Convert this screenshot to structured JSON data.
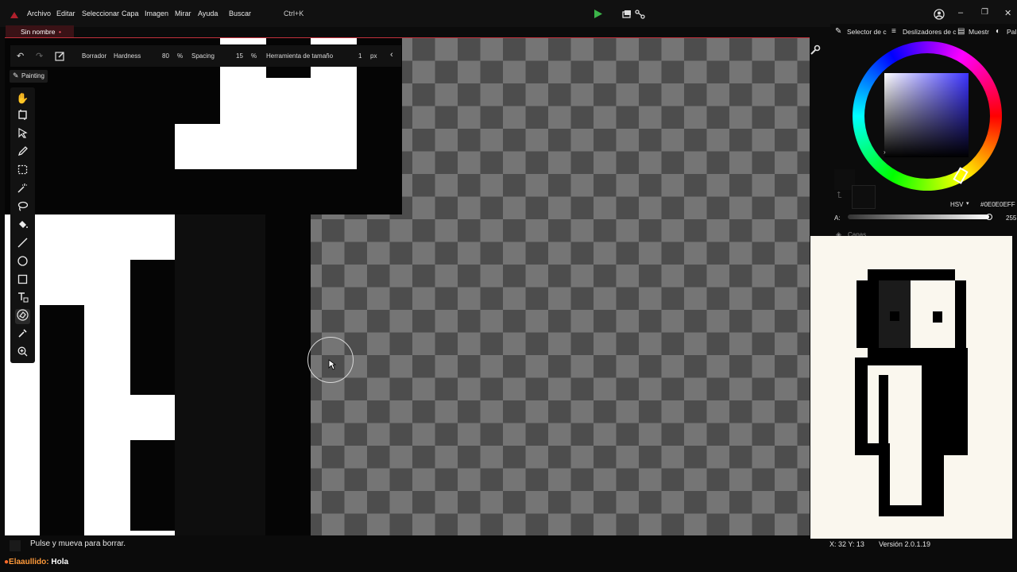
{
  "menubar": {
    "items": [
      "Archivo",
      "Editar",
      "Seleccionar",
      "Capa",
      "Imagen",
      "Mirar",
      "Ayuda",
      "Buscar"
    ],
    "search_shortcut": "Ctrl+K"
  },
  "document": {
    "tab_label": "Sin nombre",
    "unsaved_mark": "•"
  },
  "tool_options": {
    "tool_name": "Borrador",
    "hardness_label": "Hardness",
    "hardness_value": "80",
    "hardness_unit": "%",
    "spacing_label": "Spacing",
    "spacing_value": "15",
    "spacing_unit": "%",
    "size_label": "Herramienta de tamaño",
    "size_value": "1",
    "size_unit": "px"
  },
  "mode_tab": {
    "label": "Painting"
  },
  "right_panel": {
    "tabs": [
      "Selector de c",
      "Deslizadores de c",
      "Muestr",
      "Pal"
    ],
    "color_mode": "HSV",
    "hex_value": "#0E0E0EFF",
    "alpha_label": "A:",
    "alpha_value": "255",
    "layers_label": "Capas"
  },
  "status": {
    "hint": "Pulse y mueva para borrar.",
    "coords": "X: 32 Y: 13",
    "version": "Versión 2.0.1.19"
  },
  "chat": {
    "user": "Elaaullido:",
    "message": "Hola"
  },
  "colors": {
    "accent": "#c2303b",
    "foreground": "#0E0E0E",
    "checker_dark": "#4d4d4d",
    "checker_light": "#757575",
    "preview_bg": "#faf7ee"
  },
  "toolbar": {
    "tools": [
      "hand-icon",
      "crop-icon",
      "move-arrow-icon",
      "pencil-icon",
      "rect-select-icon",
      "magic-wand-icon",
      "lasso-icon",
      "bucket-icon",
      "line-icon",
      "ellipse-icon",
      "rectangle-icon",
      "text-icon",
      "eraser-icon",
      "eyedropper-icon",
      "zoom-icon"
    ],
    "active_tool": "eraser-icon"
  }
}
